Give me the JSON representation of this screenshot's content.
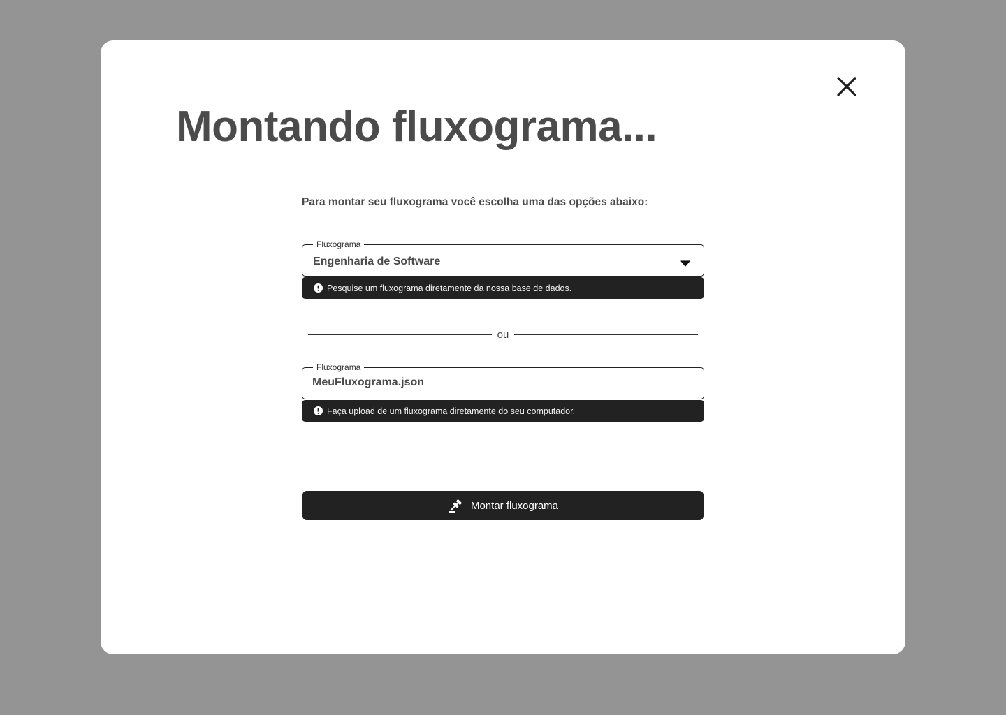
{
  "modal": {
    "title": "Montando fluxograma...",
    "instructions": "Para montar seu fluxograma você escolha uma das opções abaixo:",
    "close_icon": "close-icon"
  },
  "select_field": {
    "legend": "Fluxograma",
    "value": "Engenharia de Software",
    "helper": "Pesquise um fluxograma diretamente da nossa base de dados.",
    "arrow_icon": "caret-down-icon",
    "helper_icon": "alert-circle-icon"
  },
  "divider": {
    "label": "ou"
  },
  "upload_field": {
    "legend": "Fluxograma",
    "value": "MeuFluxograma.json",
    "helper": "Faça upload de um fluxograma diretamente do seu computador.",
    "helper_icon": "alert-circle-icon"
  },
  "submit": {
    "label": "Montar fluxograma",
    "icon": "gavel-icon"
  },
  "colors": {
    "backdrop": "#949494",
    "modal": "#ffffff",
    "dark": "#222222",
    "title": "#4b4b4b"
  }
}
